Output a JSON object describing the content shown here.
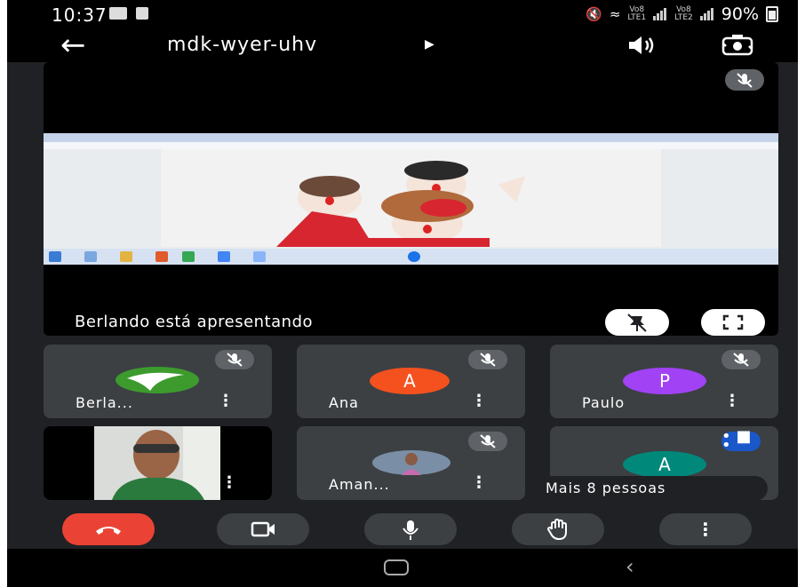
{
  "status_bar": {
    "time": "10:37",
    "sim1": "Vo8\nLTE1",
    "sim2": "Vo8\nLTE2",
    "battery": "90%"
  },
  "header": {
    "back_icon": "arrow-left-icon",
    "meeting_code": "mdk-wyer-uhv",
    "expand_icon": "caret-right-icon",
    "speaker_icon": "speaker-icon",
    "switch_camera_icon": "camera-switch-icon"
  },
  "presentation": {
    "presenter_label": "Berlando está apresentando",
    "unpin_icon": "unpin-icon",
    "fullscreen_icon": "fullscreen-icon"
  },
  "participants": [
    {
      "name": "Berla...",
      "avatar": "",
      "avatar_color": "#3d9b2e",
      "muted": true
    },
    {
      "name": "Ana",
      "avatar": "A",
      "avatar_color": "#f4511e",
      "muted": true
    },
    {
      "name": "Paulo",
      "avatar": "P",
      "avatar_color": "#a142f4",
      "muted": true
    },
    {
      "name": "",
      "avatar": "",
      "avatar_color": "#2b7a3d",
      "muted": false
    },
    {
      "name": "Aman...",
      "avatar": "",
      "avatar_color": "#7a8fa6",
      "muted": true
    },
    {
      "name": "",
      "avatar": "A",
      "avatar_color": "#00897b",
      "muted": false
    }
  ],
  "more_people_label": "Mais 8 pessoas",
  "controls": {
    "end_call_icon": "phone-hangup-icon",
    "camera_icon": "video-camera-icon",
    "mic_icon": "microphone-icon",
    "raise_hand_icon": "raise-hand-icon",
    "more_icon": "more-vert-icon"
  },
  "colors": {
    "background": "#202124",
    "tile": "#3c4043",
    "end_call": "#ea4335",
    "speaking_badge": "#1a57c9"
  }
}
